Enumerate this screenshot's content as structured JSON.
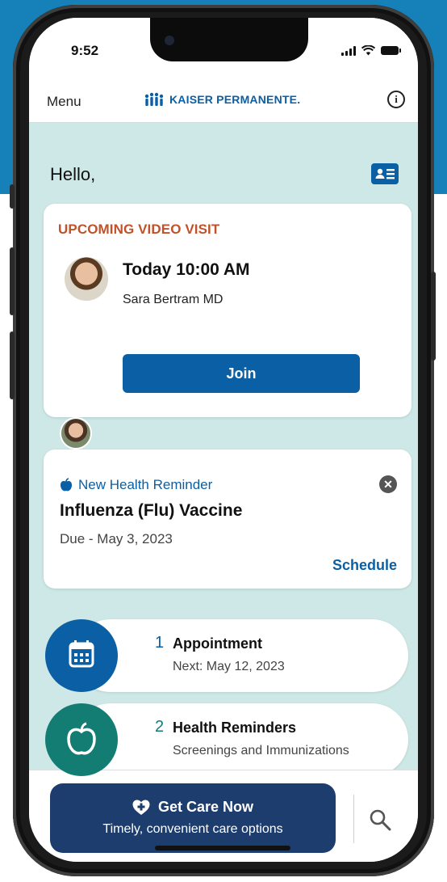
{
  "status_bar": {
    "time": "9:52"
  },
  "header": {
    "menu_label": "Menu",
    "logo_text": "KAISER PERMANENTE.",
    "info_icon": "info-icon"
  },
  "greeting": "Hello,",
  "video_visit": {
    "label": "UPCOMING VIDEO VISIT",
    "time": "Today 10:00 AM",
    "doctor": "Sara Bertram MD",
    "join_label": "Join"
  },
  "health_reminder": {
    "tag": "New Health Reminder",
    "title": "Influenza (Flu) Vaccine",
    "due": "Due - May 3, 2023",
    "schedule_label": "Schedule"
  },
  "summary": [
    {
      "count": "1",
      "title": "Appointment",
      "subtitle": "Next: May 12, 2023",
      "icon": "calendar-icon"
    },
    {
      "count": "2",
      "title": "Health Reminders",
      "subtitle": "Screenings and Immunizations",
      "icon": "apple-icon"
    }
  ],
  "bottom_bar": {
    "get_care_label": "Get Care Now",
    "get_care_sub": "Timely, convenient care options",
    "search_icon": "search-icon"
  },
  "colors": {
    "brand_blue": "#0b5fa5",
    "background_teal": "#cde8e6",
    "video_label_orange": "#c0522a",
    "reminder_green": "#137d74",
    "get_care_navy": "#1d3d6e",
    "outer_blue": "#1581b8"
  }
}
